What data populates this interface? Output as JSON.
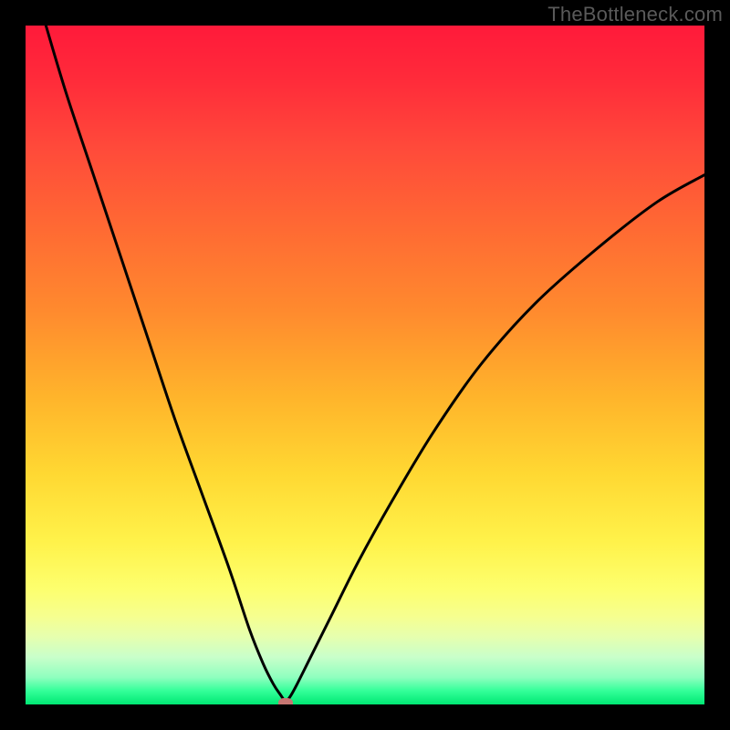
{
  "watermark": "TheBottleneck.com",
  "chart_data": {
    "type": "line",
    "title": "",
    "xlabel": "",
    "ylabel": "",
    "xlim": [
      0,
      100
    ],
    "ylim": [
      0,
      100
    ],
    "grid": false,
    "series": [
      {
        "name": "bottleneck-curve",
        "x": [
          3,
          6,
          10,
          14,
          18,
          22,
          26,
          30,
          33,
          35,
          36.5,
          37.5,
          38.3,
          39,
          40,
          42,
          45,
          49,
          54,
          60,
          67,
          75,
          84,
          93,
          100
        ],
        "y": [
          100,
          90,
          78,
          66,
          54,
          42,
          31,
          20,
          11,
          6,
          3,
          1.5,
          0.5,
          1.2,
          3,
          7,
          13,
          21,
          30,
          40,
          50,
          59,
          67,
          74,
          78
        ]
      }
    ],
    "annotations": [
      {
        "name": "optimal-marker",
        "x": 38.3,
        "y": 0.2
      }
    ],
    "background": {
      "type": "vertical-gradient",
      "stops": [
        {
          "pos": 0,
          "color": "#ff1a3a"
        },
        {
          "pos": 50,
          "color": "#ffb52b"
        },
        {
          "pos": 80,
          "color": "#fdff6e"
        },
        {
          "pos": 100,
          "color": "#00e873"
        }
      ],
      "meaning": "top=bad, bottom=optimal"
    }
  },
  "colors": {
    "curve": "#000000",
    "marker": "#c77672",
    "frame": "#000000"
  }
}
